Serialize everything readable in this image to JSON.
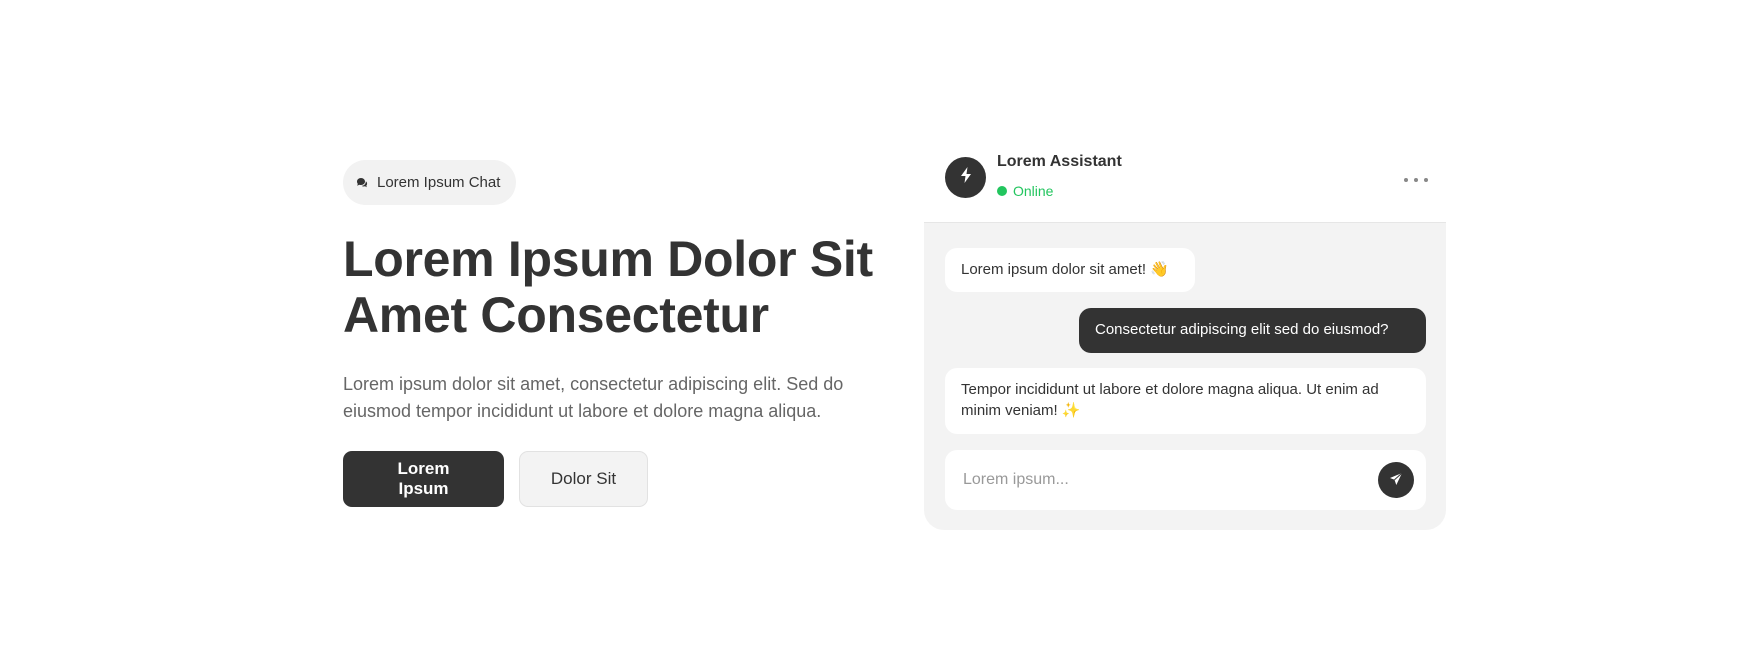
{
  "hero": {
    "badge_icon": "chat-bubble-icon",
    "badge_label": "Lorem Ipsum Chat",
    "title_line1": "Lorem Ipsum Dolor Sit",
    "title_line2": "Amet Consectetur",
    "description": "Lorem ipsum dolor sit amet, consectetur adipiscing elit. Sed do eiusmod tempor incididunt ut labore et dolore magna aliqua.",
    "primary_button": "Lorem Ipsum",
    "secondary_button": "Dolor Sit"
  },
  "chat": {
    "avatar_icon": "lightning-bolt-icon",
    "assistant_name": "Lorem Assistant",
    "status": "Online",
    "status_color": "#22c55e",
    "menu_icon": "more-horizontal-icon",
    "messages": [
      {
        "role": "assistant",
        "text": "Lorem ipsum dolor sit amet! 👋"
      },
      {
        "role": "user",
        "text": "Consectetur adipiscing elit sed do eiusmod?"
      },
      {
        "role": "assistant",
        "text": "Tempor incididunt ut labore et dolore magna aliqua. Ut enim ad minim veniam! ✨"
      }
    ],
    "input_placeholder": "Lorem ipsum...",
    "send_icon": "send-icon"
  },
  "colors": {
    "primary": "#333333",
    "surface": "#f3f3f3",
    "online": "#22c55e"
  }
}
